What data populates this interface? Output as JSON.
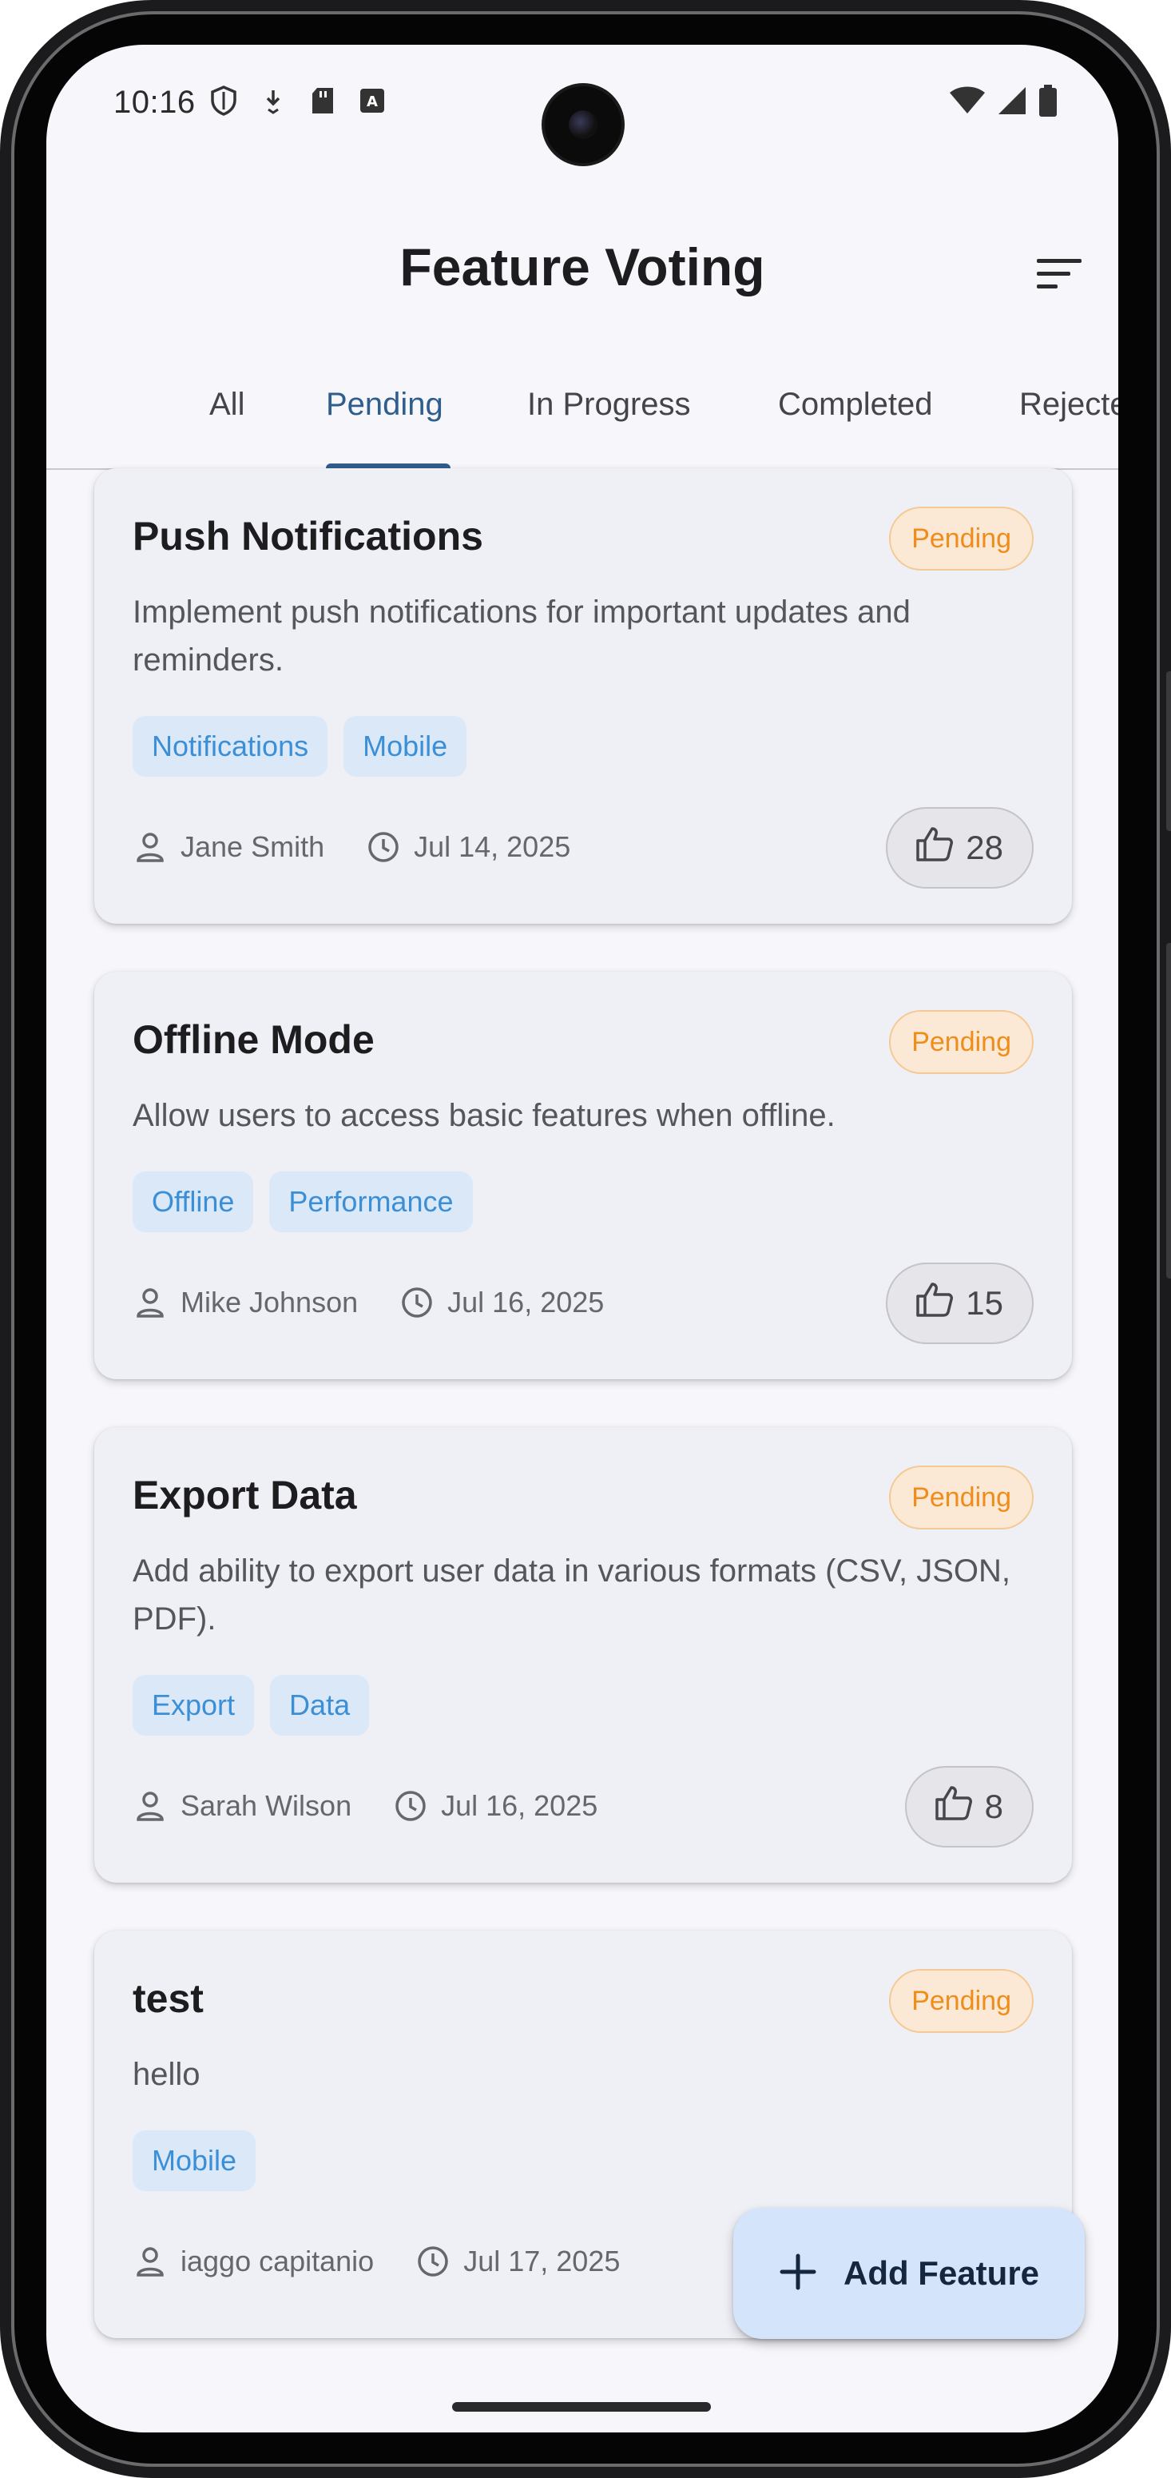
{
  "status_bar": {
    "time": "10:16"
  },
  "app_bar": {
    "title": "Feature Voting",
    "sort_icon": "sort-icon"
  },
  "tabs": [
    {
      "label": "All",
      "active": false
    },
    {
      "label": "Pending",
      "active": true
    },
    {
      "label": "In Progress",
      "active": false
    },
    {
      "label": "Completed",
      "active": false
    },
    {
      "label": "Rejected",
      "active": false
    }
  ],
  "features": [
    {
      "title": "Push Notifications",
      "status": "Pending",
      "description": "Implement push notifications for important updates and reminders.",
      "tags": [
        "Notifications",
        "Mobile"
      ],
      "author": "Jane Smith",
      "date": "Jul 14, 2025",
      "votes": "28"
    },
    {
      "title": "Offline Mode",
      "status": "Pending",
      "description": "Allow users to access basic features when offline.",
      "tags": [
        "Offline",
        "Performance"
      ],
      "author": "Mike Johnson",
      "date": "Jul 16, 2025",
      "votes": "15"
    },
    {
      "title": "Export Data",
      "status": "Pending",
      "description": "Add ability to export user data in various formats (CSV, JSON, PDF).",
      "tags": [
        "Export",
        "Data"
      ],
      "author": "Sarah Wilson",
      "date": "Jul 16, 2025",
      "votes": "8"
    },
    {
      "title": "test",
      "status": "Pending",
      "description": "hello",
      "tags": [
        "Mobile"
      ],
      "author": "iaggo capitanio",
      "date": "Jul 17, 2025",
      "votes": ""
    }
  ],
  "fab": {
    "label": "Add Feature",
    "icon": "plus-icon"
  },
  "colors": {
    "accent": "#2f5d8c",
    "pending_badge_text": "#f08c1a",
    "tag_text": "#3b8fd6",
    "fab_bg": "#d4e4fb"
  }
}
